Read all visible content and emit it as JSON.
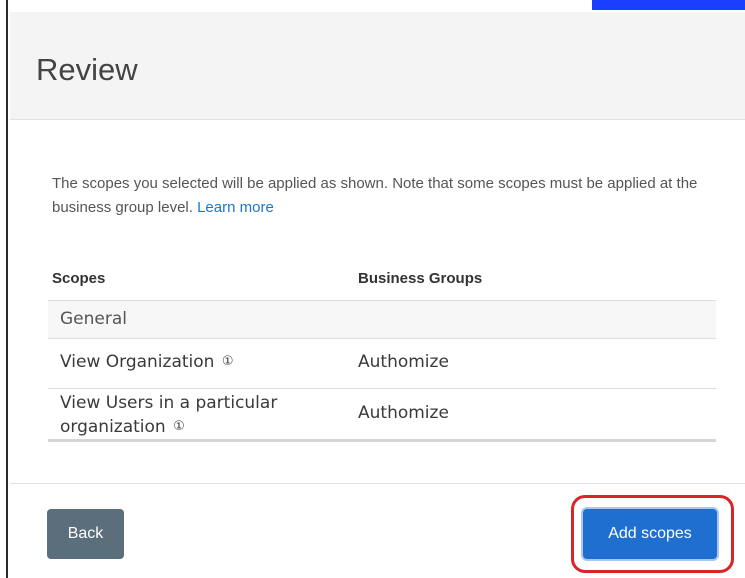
{
  "modal": {
    "title": "Review",
    "intro_text": "The scopes you selected will be applied as shown. Note that some scopes must be applied at the business group level.",
    "learn_more": "Learn more"
  },
  "table": {
    "headers": {
      "scopes": "Scopes",
      "business_groups": "Business Groups"
    },
    "group_label": "General",
    "rows": [
      {
        "scope": "View Organization",
        "business_group": "Authomize"
      },
      {
        "scope": "View Users in a particular organization",
        "business_group": "Authomize"
      }
    ]
  },
  "icons": {
    "info": "info-circle-icon",
    "info_glyph": "①"
  },
  "footer": {
    "back_label": "Back",
    "add_label": "Add scopes"
  },
  "colors": {
    "primary": "#1f6fd0",
    "back": "#5a6e7b",
    "highlight": "#d9242a",
    "link": "#1f77c9"
  }
}
